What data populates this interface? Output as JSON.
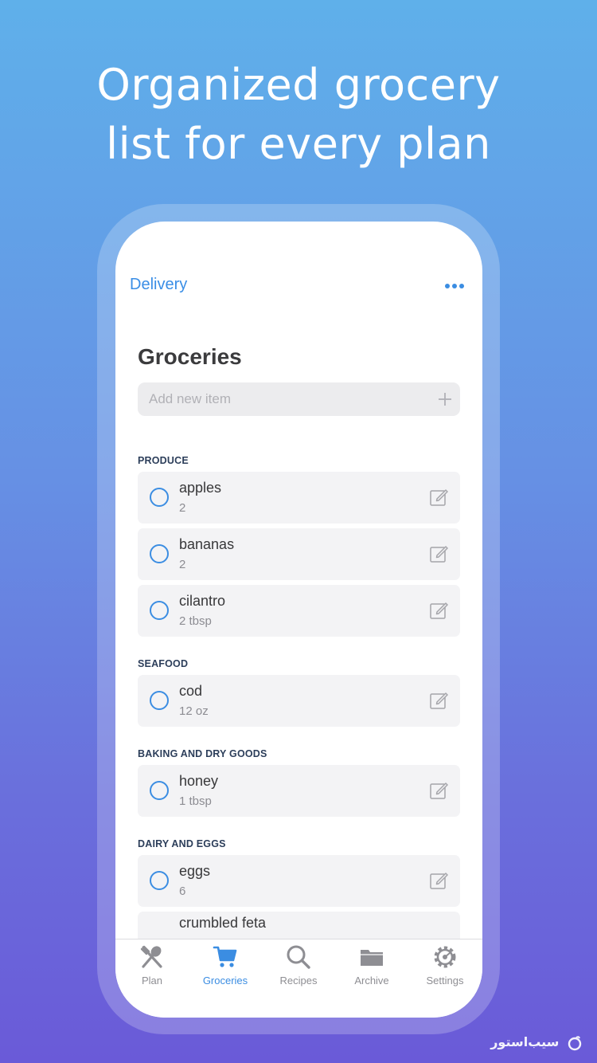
{
  "headline": {
    "line1": "Organized grocery",
    "line2": "list for every plan"
  },
  "nav": {
    "left_label": "Delivery",
    "more_icon": "ellipsis-icon"
  },
  "page": {
    "title": "Groceries"
  },
  "add_item": {
    "placeholder": "Add new item",
    "icon": "plus-icon"
  },
  "colors": {
    "accent": "#3b8de2",
    "background_top": "#5fb0ea",
    "background_bottom": "#6a5ad8"
  },
  "categories": [
    {
      "label": "PRODUCE",
      "items": [
        {
          "name": "apples",
          "qty": "2"
        },
        {
          "name": "bananas",
          "qty": "2"
        },
        {
          "name": "cilantro",
          "qty": "2 tbsp"
        }
      ]
    },
    {
      "label": "SEAFOOD",
      "items": [
        {
          "name": "cod",
          "qty": "12 oz"
        }
      ]
    },
    {
      "label": "BAKING AND DRY GOODS",
      "items": [
        {
          "name": "honey",
          "qty": "1 tbsp"
        }
      ]
    },
    {
      "label": "DAIRY AND EGGS",
      "items": [
        {
          "name": "eggs",
          "qty": "6"
        },
        {
          "name": "crumbled feta",
          "qty": ""
        }
      ]
    }
  ],
  "tabs": [
    {
      "label": "Plan",
      "icon": "fork-spoon-icon",
      "active": false
    },
    {
      "label": "Groceries",
      "icon": "cart-icon",
      "active": true
    },
    {
      "label": "Recipes",
      "icon": "search-icon",
      "active": false
    },
    {
      "label": "Archive",
      "icon": "folder-icon",
      "active": false
    },
    {
      "label": "Settings",
      "icon": "gear-icon",
      "active": false
    }
  ],
  "watermark": {
    "text": "سیب‌استور"
  }
}
